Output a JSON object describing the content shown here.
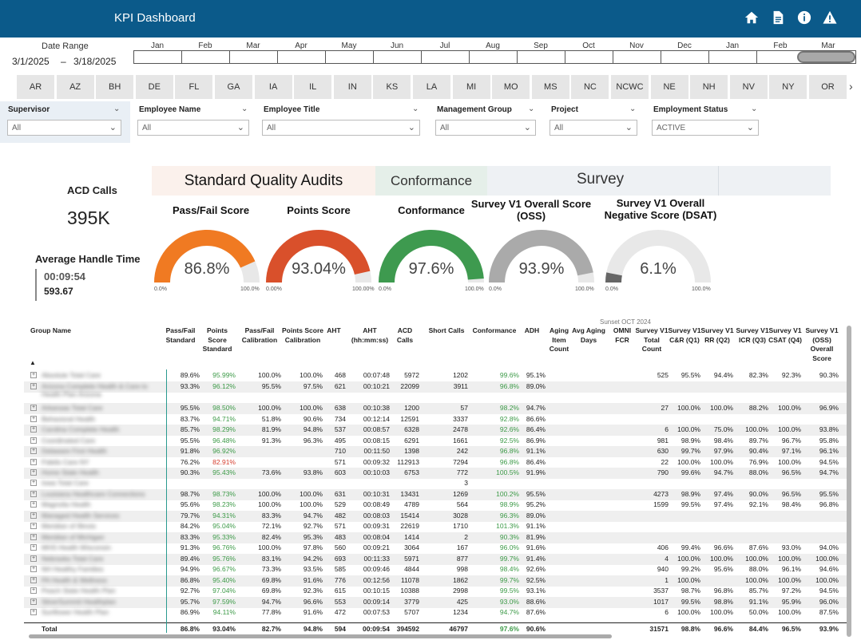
{
  "app": {
    "title": "KPI Dashboard"
  },
  "toolbar": {
    "icons": [
      "home-icon",
      "document-icon",
      "info-icon",
      "warning-icon"
    ]
  },
  "date_range": {
    "label": "Date Range",
    "start": "3/1/2025",
    "dash": "–",
    "end": "3/18/2025"
  },
  "timeline": {
    "months": [
      "Jan",
      "Feb",
      "Mar",
      "Apr",
      "May",
      "Jun",
      "Jul",
      "Aug",
      "Sep",
      "Oct",
      "Nov",
      "Dec",
      "Jan",
      "Feb",
      "Mar"
    ]
  },
  "states": [
    "AR",
    "AZ",
    "BH",
    "DE",
    "FL",
    "GA",
    "IA",
    "IL",
    "IN",
    "KS",
    "LA",
    "MI",
    "MO",
    "MS",
    "NC",
    "NCWC",
    "NE",
    "NH",
    "NV",
    "NY",
    "OR"
  ],
  "filters": [
    {
      "label": "Supervisor",
      "value": "All"
    },
    {
      "label": "Employee Name",
      "value": "All"
    },
    {
      "label": "Employee Title",
      "value": "All"
    },
    {
      "label": "Management Group",
      "value": "All"
    },
    {
      "label": "Project",
      "value": "All"
    },
    {
      "label": "Employment Status",
      "value": "ACTIVE"
    }
  ],
  "sections": {
    "sqa": "Standard Quality Audits",
    "conformance": "Conformance",
    "survey": "Survey"
  },
  "kpi": {
    "acd_label": "ACD Calls",
    "acd_value": "395K",
    "aht_label": "Average Handle Time",
    "aht_time": "00:09:54",
    "aht_seconds": "593.67"
  },
  "gauges": [
    {
      "title": "Pass/Fail Score",
      "value": "86.8%",
      "pct": 86.8,
      "color": "#f07a22",
      "min": "0.0%",
      "max": "100.0%"
    },
    {
      "title": "Points Score",
      "value": "93.04%",
      "pct": 93.04,
      "color": "#d9502b",
      "min": "0.00%",
      "max": "100.00%"
    },
    {
      "title": "Conformance",
      "value": "97.6%",
      "pct": 97.6,
      "color": "#3e9a4f",
      "min": "0.0%",
      "max": "100.0%"
    },
    {
      "title": "Survey V1 Overall Score (OSS)",
      "value": "93.9%",
      "pct": 93.9,
      "color": "#aaaaaa",
      "min": "0.0%",
      "max": "100.0%"
    },
    {
      "title": "Survey V1 Overall Negative Score (DSAT)",
      "value": "6.1%",
      "pct": 6.1,
      "color": "#666666",
      "min": "0.0%",
      "max": "100.0%"
    }
  ],
  "table": {
    "sunset_label": "Sunset OCT 2024",
    "group_header": "Group Name",
    "headers": [
      "Pass/Fail Standard",
      "Points Score Standard",
      "Pass/Fail Calibration",
      "Points Score Calibration",
      "AHT",
      "AHT (hh:mm:ss)",
      "ACD Calls",
      "Short Calls",
      "Conformance",
      "ADH",
      "Aging Item Count",
      "Avg Aging Days",
      "OMNI FCR",
      "Survey V1 Total Count",
      "Survey V1 C&R (Q1)",
      "Survey V1 RR (Q2)",
      "Survey V1 ICR (Q3)",
      "Survey V1 CSAT (Q4)",
      "Survey V1 (OSS) Overall Score"
    ],
    "rows": [
      [
        "Absolute Total Care",
        "89.6%",
        "95.99%",
        "100.0%",
        "100.0%",
        "468",
        "00:07:48",
        "5972",
        "1202",
        "99.6%",
        "95.1%",
        "",
        "",
        "",
        "525",
        "95.5%",
        "94.4%",
        "82.3%",
        "92.3%",
        "90.3%"
      ],
      [
        "Arizona Complete Health & Care to Health Plan Arizona",
        "93.3%",
        "96.12%",
        "95.5%",
        "97.5%",
        "621",
        "00:10:21",
        "22099",
        "3911",
        "96.8%",
        "89.0%",
        "",
        "",
        "",
        "",
        "",
        "",
        "",
        "",
        ""
      ],
      [
        "",
        ""
      ],
      [
        "Arkansas Total Care",
        "95.5%",
        "98.50%",
        "100.0%",
        "100.0%",
        "638",
        "00:10:38",
        "1200",
        "57",
        "98.2%",
        "94.7%",
        "",
        "",
        "",
        "27",
        "100.0%",
        "100.0%",
        "88.2%",
        "100.0%",
        "96.9%"
      ],
      [
        "Behavioral Health",
        "83.7%",
        "94.71%",
        "51.8%",
        "90.6%",
        "734",
        "00:12:14",
        "12591",
        "3337",
        "92.8%",
        "86.6%",
        "",
        "",
        "",
        "",
        "",
        "",
        "",
        "",
        ""
      ],
      [
        "Carolina Complete Health",
        "85.7%",
        "98.29%",
        "81.9%",
        "94.8%",
        "537",
        "00:08:57",
        "6328",
        "2478",
        "92.6%",
        "86.4%",
        "",
        "",
        "",
        "6",
        "100.0%",
        "75.0%",
        "100.0%",
        "100.0%",
        "93.8%"
      ],
      [
        "Coordinated Care",
        "95.5%",
        "96.48%",
        "91.3%",
        "96.3%",
        "495",
        "00:08:15",
        "6291",
        "1661",
        "92.5%",
        "86.9%",
        "",
        "",
        "",
        "981",
        "98.9%",
        "98.4%",
        "89.7%",
        "96.7%",
        "95.8%"
      ],
      [
        "Delaware First Health",
        "91.8%",
        "96.92%",
        "",
        "",
        "710",
        "00:11:50",
        "1398",
        "242",
        "96.8%",
        "91.1%",
        "",
        "",
        "",
        "630",
        "99.7%",
        "97.9%",
        "90.4%",
        "97.1%",
        "96.1%"
      ],
      [
        "Fidelis Care NY",
        "76.2%",
        "82.91%",
        "",
        "",
        "571",
        "00:09:32",
        "112913",
        "7294",
        "96.8%",
        "86.4%",
        "",
        "",
        "",
        "22",
        "100.0%",
        "100.0%",
        "76.9%",
        "100.0%",
        "94.5%"
      ],
      [
        "Home State Health",
        "90.3%",
        "95.43%",
        "73.6%",
        "93.8%",
        "603",
        "00:10:03",
        "6753",
        "772",
        "100.5%",
        "91.9%",
        "",
        "",
        "",
        "790",
        "99.6%",
        "94.7%",
        "88.0%",
        "96.5%",
        "94.7%"
      ],
      [
        "Iowa Total Care",
        "",
        "",
        "",
        "",
        "",
        "",
        "",
        "3",
        "",
        "",
        "",
        "",
        "",
        "",
        "",
        "",
        "",
        "",
        ""
      ],
      [
        "Louisiana Healthcare Connections",
        "98.7%",
        "98.73%",
        "100.0%",
        "100.0%",
        "631",
        "00:10:31",
        "13431",
        "1269",
        "100.2%",
        "95.5%",
        "",
        "",
        "",
        "4273",
        "98.9%",
        "97.4%",
        "90.0%",
        "96.5%",
        "95.5%"
      ],
      [
        "Magnolia Health",
        "95.6%",
        "98.23%",
        "100.0%",
        "100.0%",
        "529",
        "00:08:49",
        "4789",
        "564",
        "98.9%",
        "95.2%",
        "",
        "",
        "",
        "1599",
        "99.5%",
        "97.4%",
        "92.1%",
        "98.4%",
        "96.8%"
      ],
      [
        "Managed Health Services",
        "79.7%",
        "94.31%",
        "83.3%",
        "94.7%",
        "482",
        "00:08:03",
        "15414",
        "3028",
        "96.3%",
        "89.0%",
        "",
        "",
        "",
        "",
        "",
        "",
        "",
        "",
        ""
      ],
      [
        "Meridian of Illinois",
        "84.2%",
        "95.04%",
        "72.1%",
        "92.7%",
        "571",
        "00:09:31",
        "22619",
        "1710",
        "101.3%",
        "91.1%",
        "",
        "",
        "",
        "",
        "",
        "",
        "",
        "",
        ""
      ],
      [
        "Meridian of Michigan",
        "83.3%",
        "95.33%",
        "82.4%",
        "95.3%",
        "483",
        "00:08:04",
        "1414",
        "2",
        "90.3%",
        "81.9%",
        "",
        "",
        "",
        "",
        "",
        "",
        "",
        "",
        ""
      ],
      [
        "MHS Health Wisconsin",
        "91.3%",
        "96.76%",
        "100.0%",
        "97.8%",
        "560",
        "00:09:21",
        "3064",
        "167",
        "96.0%",
        "91.6%",
        "",
        "",
        "",
        "406",
        "99.4%",
        "96.6%",
        "87.6%",
        "93.0%",
        "94.0%"
      ],
      [
        "Nebraska Total Care",
        "89.4%",
        "95.76%",
        "83.1%",
        "94.2%",
        "693",
        "00:11:33",
        "5971",
        "877",
        "99.7%",
        "91.4%",
        "",
        "",
        "",
        "4",
        "100.0%",
        "100.0%",
        "100.0%",
        "100.0%",
        "100.0%"
      ],
      [
        "NH Healthy Families",
        "94.9%",
        "96.67%",
        "73.3%",
        "93.5%",
        "585",
        "00:09:46",
        "4844",
        "998",
        "98.4%",
        "92.6%",
        "",
        "",
        "",
        "940",
        "99.2%",
        "95.6%",
        "88.0%",
        "96.1%",
        "94.6%"
      ],
      [
        "PA Health & Wellness",
        "86.8%",
        "95.40%",
        "69.8%",
        "91.6%",
        "776",
        "00:12:56",
        "11078",
        "1862",
        "99.7%",
        "92.5%",
        "",
        "",
        "",
        "1",
        "100.0%",
        "",
        "100.0%",
        "100.0%",
        "100.0%"
      ],
      [
        "Peach State Health Plan",
        "92.7%",
        "97.04%",
        "69.8%",
        "92.3%",
        "615",
        "00:10:15",
        "10388",
        "2998",
        "99.5%",
        "93.1%",
        "",
        "",
        "",
        "3537",
        "98.7%",
        "96.8%",
        "85.7%",
        "97.2%",
        "94.5%"
      ],
      [
        "SilverSummit Healthplan",
        "95.7%",
        "97.59%",
        "94.7%",
        "96.6%",
        "553",
        "00:09:14",
        "3779",
        "425",
        "93.0%",
        "88.6%",
        "",
        "",
        "",
        "1017",
        "99.5%",
        "98.8%",
        "91.1%",
        "95.9%",
        "96.0%"
      ],
      [
        "Sunflower Health Plan",
        "86.9%",
        "94.11%",
        "77.8%",
        "91.6%",
        "472",
        "00:07:53",
        "5707",
        "1234",
        "94.7%",
        "87.6%",
        "",
        "",
        "",
        "6",
        "100.0%",
        "100.0%",
        "50.0%",
        "100.0%",
        "87.5%"
      ]
    ],
    "total": [
      "Total",
      "86.8%",
      "93.04%",
      "82.7%",
      "94.8%",
      "594",
      "00:09:54",
      "394592",
      "46797",
      "97.6%",
      "90.6%",
      "",
      "",
      "",
      "31571",
      "98.8%",
      "96.6%",
      "84.4%",
      "96.5%",
      "93.9%"
    ]
  }
}
